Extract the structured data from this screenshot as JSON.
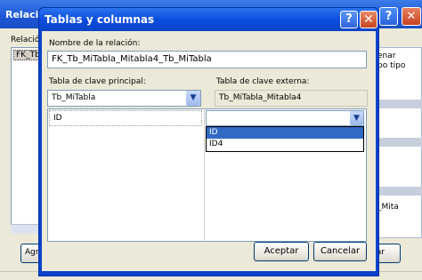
{
  "background_window": {
    "title": "Relacio",
    "relations_label": "Relación",
    "list_item": "FK_Tb",
    "right_text_line1": "enar",
    "right_text_line2": "po tipo",
    "right_text_bottom": "_Mita",
    "add_button": "Agre",
    "delete_button": "rar",
    "help_glyph": "?",
    "close_glyph": "✕"
  },
  "dialog": {
    "title": "Tablas y columnas",
    "help_glyph": "?",
    "close_glyph": "✕",
    "relation_name_label": "Nombre de la relación:",
    "relation_name_value": "FK_Tb_MiTabla_Mitabla4_Tb_MiTabla",
    "pk_table_label": "Tabla de clave principal:",
    "pk_table_value": "Tb_MiTabla",
    "fk_table_label": "Tabla de clave externa:",
    "fk_table_value": "Tb_MiTabla_Mitabla4",
    "pk_column_value": "ID",
    "fk_column_value": "",
    "fk_column_options": [
      "ID",
      "ID4"
    ],
    "dropdown_glyph": "▼",
    "ok_button": "Aceptar",
    "cancel_button": "Cancelar"
  },
  "colors": {
    "titlebar": "#0b4de0",
    "selection": "#316ac5",
    "window_bg": "#ece9d8"
  },
  "icons": {
    "help": "help-icon",
    "close": "close-icon",
    "dropdown": "chevron-down-icon"
  }
}
